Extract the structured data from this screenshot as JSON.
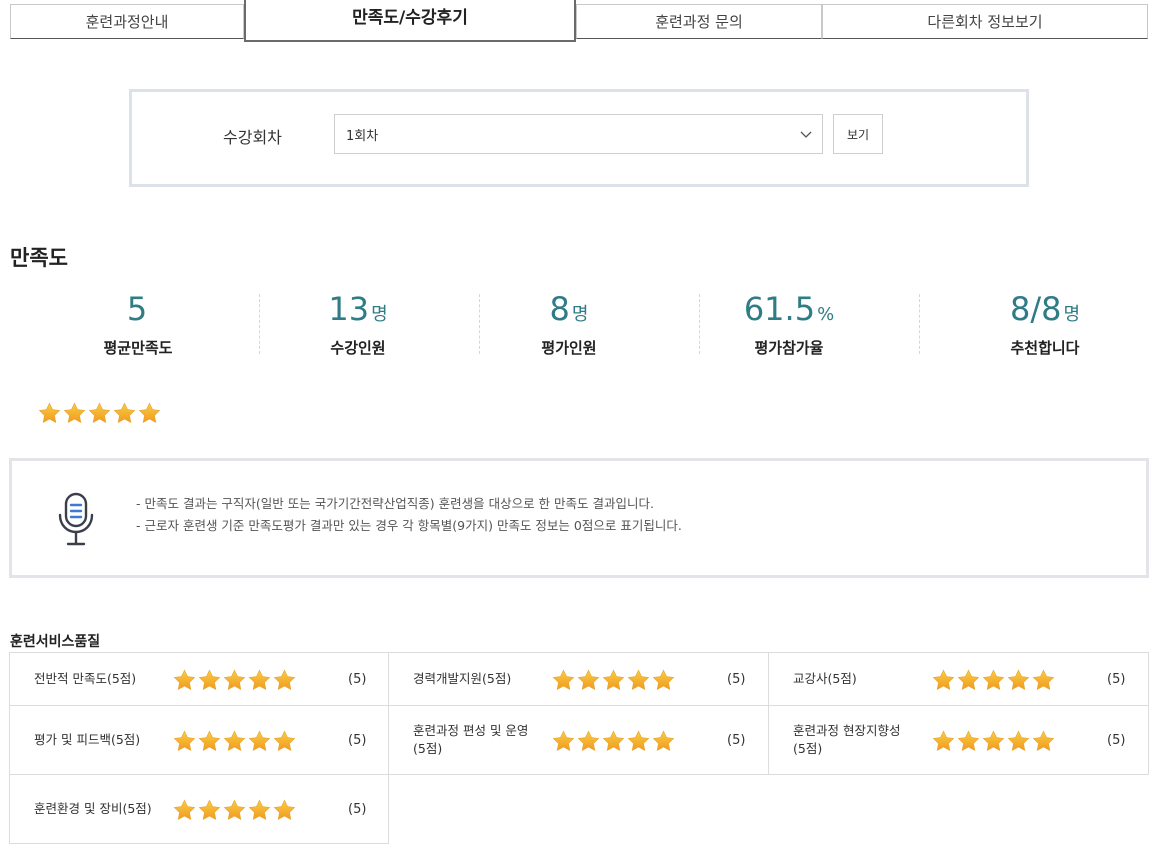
{
  "tabs": [
    "훈련과정안내",
    "만족도/수강후기",
    "훈련과정 문의",
    "다른회차 정보보기"
  ],
  "session": {
    "label": "수강회차",
    "selected": "1회차",
    "view_button": "보기"
  },
  "satisfaction": {
    "title": "만족도",
    "stats": [
      {
        "value": "5",
        "unit": "",
        "label": "평균만족도"
      },
      {
        "value": "13",
        "unit": "명",
        "label": "수강인원"
      },
      {
        "value": "8",
        "unit": "명",
        "label": "평가인원"
      },
      {
        "value": "61.5",
        "unit": "%",
        "label": "평가참가율"
      },
      {
        "value": "8/8",
        "unit": "명",
        "label": "추천합니다"
      }
    ],
    "rating": 5,
    "rating_max": 5
  },
  "notice": {
    "lines": [
      "- 만족도 결과는 구직자(일반 또는 국가기간전략산업직종) 훈련생을 대상으로 한 만족도 결과입니다.",
      "- 근로자 훈련생 기준 만족도평가 결과만 있는 경우 각 항목별(9가지) 만족도 정보는 0점으로 표기됩니다."
    ]
  },
  "quality": {
    "title": "훈련서비스품질",
    "items": [
      {
        "label": "전반적 만족도(5점)",
        "score": "(5)",
        "rating": 5
      },
      {
        "label": "경력개발지원(5점)",
        "score": "(5)",
        "rating": 5
      },
      {
        "label": "교강사(5점)",
        "score": "(5)",
        "rating": 5
      },
      {
        "label": "평가 및 피드백(5점)",
        "score": "(5)",
        "rating": 5
      },
      {
        "label": "훈련과정 편성 및 운영(5점)",
        "score": "(5)",
        "rating": 5
      },
      {
        "label": "훈련과정 현장지향성(5점)",
        "score": "(5)",
        "rating": 5
      },
      {
        "label": "훈련환경 및 장비(5점)",
        "score": "(5)",
        "rating": 5
      }
    ]
  },
  "colors": {
    "accent_teal": "#2f7c86",
    "star_top": "#f7cd45",
    "star_bottom": "#f29a1f",
    "border": "#dcdcdc"
  },
  "icons": {
    "select": "chevron-down-icon",
    "notice": "microphone-icon",
    "rating": "star-icon"
  }
}
